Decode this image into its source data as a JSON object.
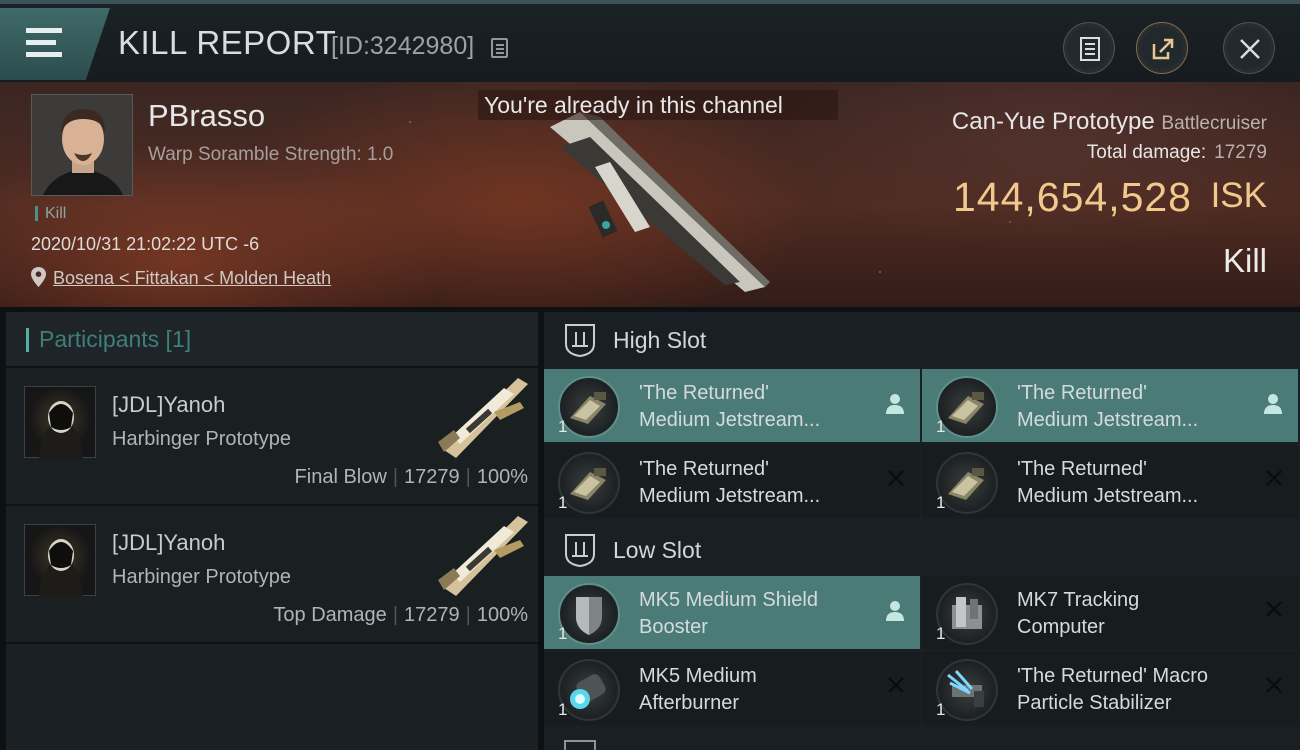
{
  "header": {
    "title": "KILL REPORT",
    "report_id": "[ID:3242980]",
    "menu_icon": "hamburger-menu-icon",
    "buttons": [
      "clipboard-icon",
      "share-icon",
      "close-icon"
    ]
  },
  "banner": {
    "toast": "You're already in this channel",
    "victim": {
      "name": "PBrasso",
      "warp_scramble": "Warp Soramble Strength: 1.0",
      "tag": "Kill",
      "timestamp": "2020/10/31 21:02:22 UTC -6",
      "location": "Bosena < Fittakan < Molden Heath"
    },
    "ship": {
      "name": "Can-Yue Prototype",
      "class": "Battlecruiser"
    },
    "total_damage_label": "Total damage:",
    "total_damage_value": "17279",
    "isk_value": "144,654,528",
    "isk_unit": "ISK",
    "result": "Kill"
  },
  "participants": {
    "header": "Participants [1]",
    "rows": [
      {
        "name": "[JDL]Yanoh",
        "ship": "Harbinger Prototype",
        "role": "Final Blow",
        "damage": "17279",
        "percent": "100%"
      },
      {
        "name": "[JDL]Yanoh",
        "ship": "Harbinger Prototype",
        "role": "Top Damage",
        "damage": "17279",
        "percent": "100%"
      }
    ]
  },
  "slots": {
    "high": {
      "label": "High Slot",
      "modules": [
        {
          "line1": "'The Returned'",
          "line2": "Medium Jetstream...",
          "qty": "1",
          "status": "pilot"
        },
        {
          "line1": "'The Returned'",
          "line2": "Medium Jetstream...",
          "qty": "1",
          "status": "pilot"
        },
        {
          "line1": "'The Returned'",
          "line2": "Medium Jetstream...",
          "qty": "1",
          "status": "destroyed"
        },
        {
          "line1": "'The Returned'",
          "line2": "Medium Jetstream...",
          "qty": "1",
          "status": "destroyed"
        }
      ]
    },
    "low": {
      "label": "Low Slot",
      "modules": [
        {
          "line1": "MK5 Medium Shield",
          "line2": "Booster",
          "qty": "1",
          "status": "pilot"
        },
        {
          "line1": "MK7 Tracking",
          "line2": "Computer",
          "qty": "1",
          "status": "destroyed"
        },
        {
          "line1": "MK5 Medium",
          "line2": "Afterburner",
          "qty": "1",
          "status": "destroyed"
        },
        {
          "line1": "'The Returned' Macro",
          "line2": "Particle Stabilizer",
          "qty": "1",
          "status": "destroyed"
        }
      ]
    }
  },
  "colors": {
    "accent": "#4a7b76",
    "isk": "#f1c98c"
  }
}
